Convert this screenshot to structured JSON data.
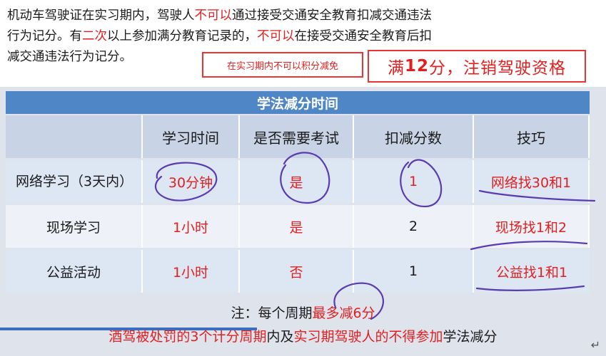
{
  "intro": {
    "line1_a": "机动车驾驶证在实习期内，驾驶人",
    "line1_red": "不可以",
    "line1_b": "通过接受交通安全教育扣减交通违法",
    "line2_a": "行为记分。有",
    "line2_red1": "二次",
    "line2_b": "以上参加满分教育记录的，",
    "line2_red2": "不可以",
    "line2_c": "在接受交通安全教育后扣",
    "line3": "减交通违法行为记分。"
  },
  "callout_small": "在实习期内不可以积分减免",
  "callout_big": {
    "a": "满",
    "num": "12",
    "b": "分，注销驾驶资格"
  },
  "table": {
    "title": "学法减分时间",
    "headers": [
      "",
      "学习时间",
      "是否需要考试",
      "扣减分数",
      "技巧"
    ],
    "rows": [
      {
        "name": "网络学习（3天内）",
        "time": "30分钟",
        "exam": "是",
        "points": "1",
        "tip": "网络找30和1"
      },
      {
        "name": "现场学习",
        "time": "1小时",
        "exam": "是",
        "points": "2",
        "tip": "现场找1和2"
      },
      {
        "name": "公益活动",
        "time": "1小时",
        "exam": "否",
        "points": "1",
        "tip": "公益找1和1"
      }
    ]
  },
  "note": {
    "a": "注：每个周期",
    "red": "最多减6分"
  },
  "footer": {
    "red1": "酒驾被处罚的3个计分周期",
    "a": "内及",
    "red2": "实习期驾驶人的不得参加",
    "b": "学法减分"
  },
  "colors": {
    "accent_red": "#e02020",
    "title_blue": "#4f86c6",
    "ink_purple": "#5b3bb0"
  },
  "icons": {
    "return_icon": "↵"
  }
}
